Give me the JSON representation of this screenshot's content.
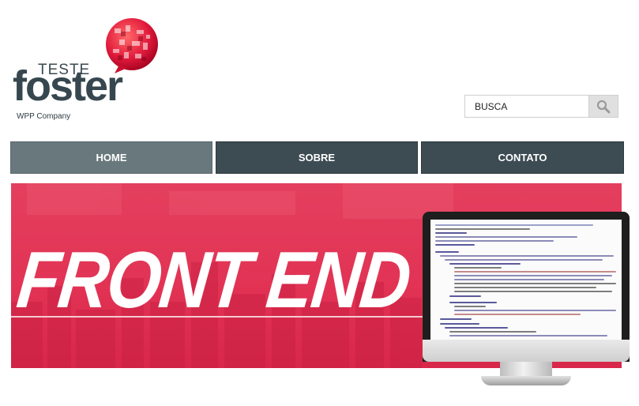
{
  "logo": {
    "teste": "TESTE",
    "foster": "foster",
    "tagline": "WPP Company"
  },
  "search": {
    "placeholder": "BUSCA"
  },
  "nav": {
    "items": [
      {
        "label": "HOME",
        "active": true
      },
      {
        "label": "SOBRE",
        "active": false
      },
      {
        "label": "CONTATO",
        "active": false
      }
    ]
  },
  "banner": {
    "title": "FRONT END"
  },
  "colors": {
    "nav_bg": "#3d4b53",
    "nav_active": "#69787d",
    "brand_red": "#e23355",
    "logo_text": "#37474f"
  },
  "icons": {
    "search": "magnifier-icon",
    "logo_mark": "speech-bubble-globe-icon"
  }
}
